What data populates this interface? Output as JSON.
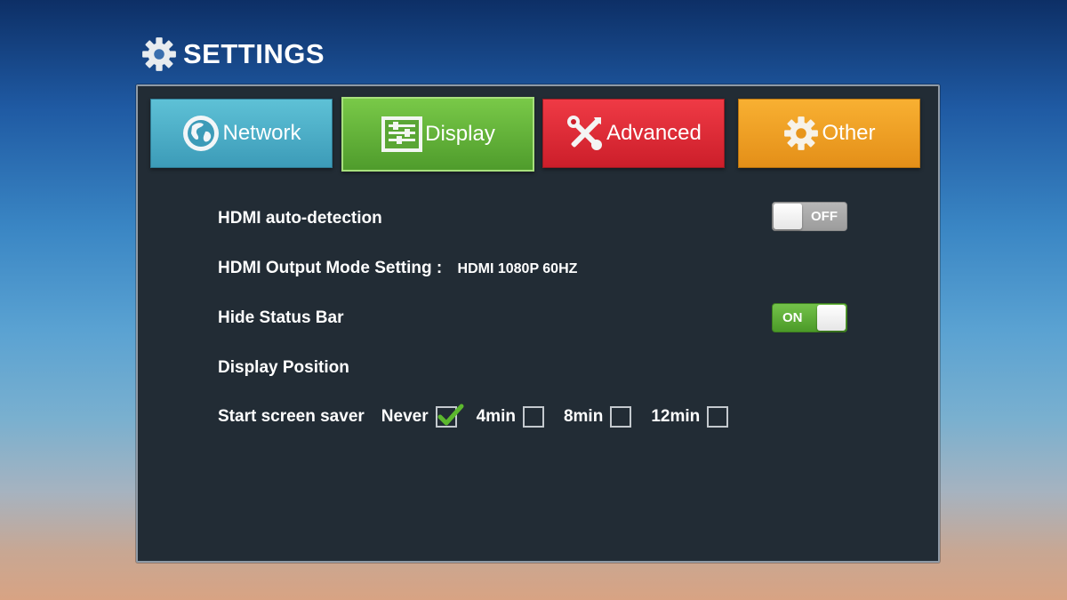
{
  "header": {
    "title": "SETTINGS",
    "icon": "gear-icon"
  },
  "tabs": [
    {
      "label": "Network",
      "icon": "globe-icon",
      "color": "#3c9bb8"
    },
    {
      "label": "Display",
      "icon": "display-sliders-icon",
      "color": "#4f9c2c",
      "selected": true
    },
    {
      "label": "Advanced",
      "icon": "tools-icon",
      "color": "#cc1e2a"
    },
    {
      "label": "Other",
      "icon": "gear-icon",
      "color": "#e48f18"
    }
  ],
  "settings": {
    "hdmi_auto": {
      "label": "HDMI auto-detection",
      "toggle": "OFF"
    },
    "output_mode": {
      "label": "HDMI Output Mode Setting :",
      "value": "HDMI 1080P 60HZ"
    },
    "hide_status": {
      "label": "Hide Status Bar",
      "toggle": "ON"
    },
    "display_position": {
      "label": "Display Position"
    },
    "screen_saver": {
      "label": "Start screen saver",
      "options": [
        {
          "label": "Never",
          "checked": true
        },
        {
          "label": "4min",
          "checked": false
        },
        {
          "label": "8min",
          "checked": false
        },
        {
          "label": "12min",
          "checked": false
        }
      ]
    }
  },
  "colors": {
    "panel_bg": "#222c35",
    "toggle_on": "#4b9a28",
    "toggle_off": "#9c9c9c",
    "check": "#5cb82e"
  }
}
